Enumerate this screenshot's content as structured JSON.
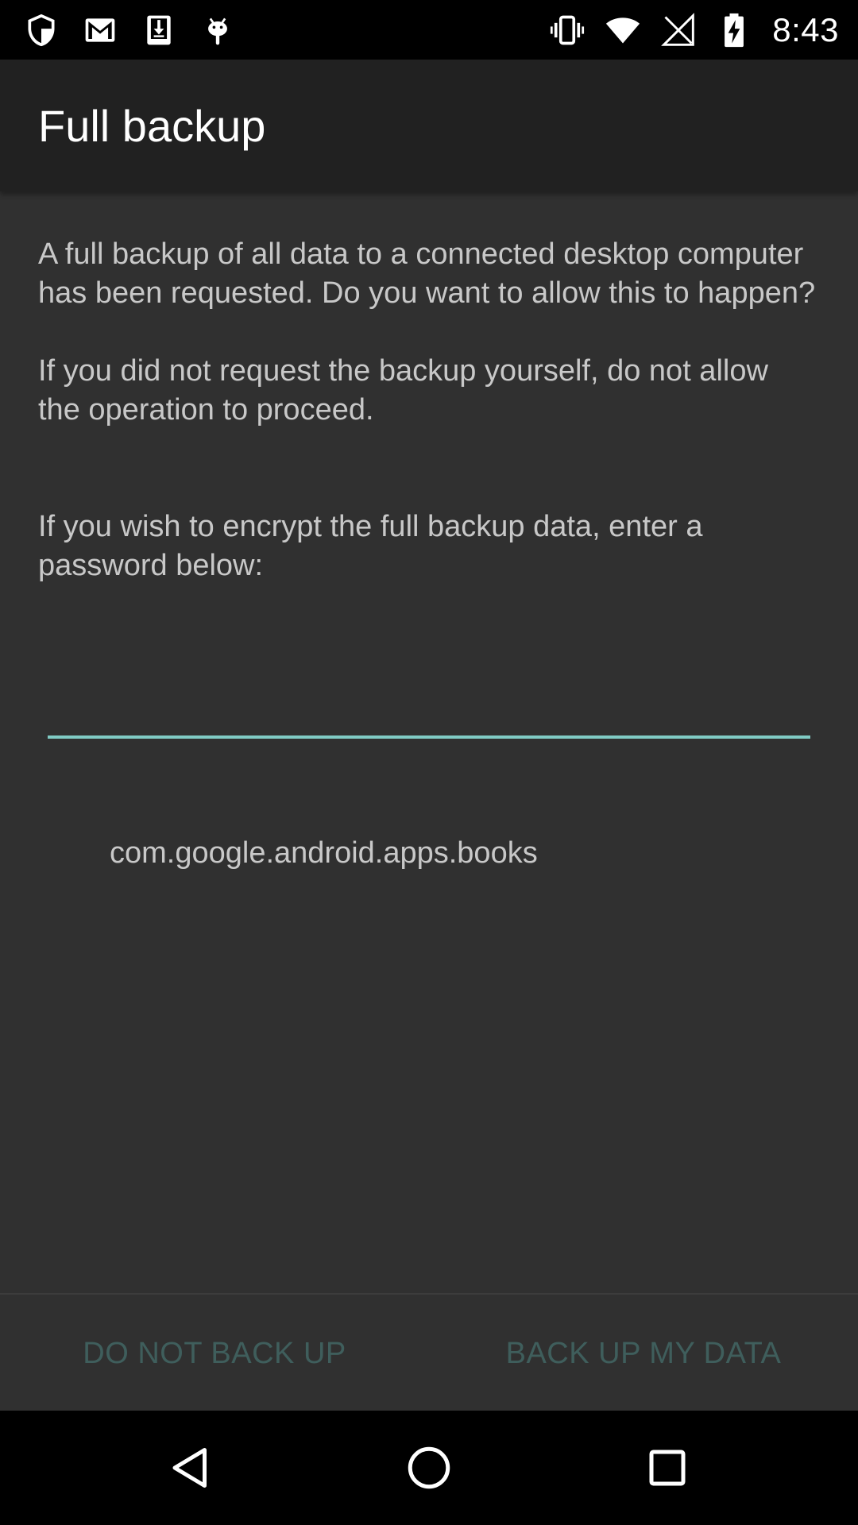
{
  "status_bar": {
    "time": "8:43",
    "left_icons": [
      "shield-icon",
      "gmail-icon",
      "download-icon",
      "android-icon"
    ],
    "right_icons": [
      "vibrate-icon",
      "wifi-icon",
      "no-signal-icon",
      "battery-charging-icon"
    ]
  },
  "app_bar": {
    "title": "Full backup"
  },
  "content": {
    "paragraph_1": "A full backup of all data to a connected desktop computer has been requested. Do you want to allow this to happen?",
    "paragraph_2": "If you did not request the backup yourself, do not allow the operation to proceed.",
    "paragraph_3": "If you wish to encrypt the full backup data, enter a password below:",
    "password": {
      "value": "",
      "placeholder": ""
    },
    "package_name": "com.google.android.apps.books"
  },
  "buttons": {
    "deny_label": "DO NOT BACK UP",
    "allow_label": "BACK UP MY DATA"
  },
  "nav_bar": {
    "icons": [
      "back-icon",
      "home-icon",
      "recents-icon"
    ]
  },
  "colors": {
    "accent": "#80cbc4",
    "button_text_disabled": "#3f5e5c",
    "background": "#303030",
    "app_bar": "#212121"
  }
}
